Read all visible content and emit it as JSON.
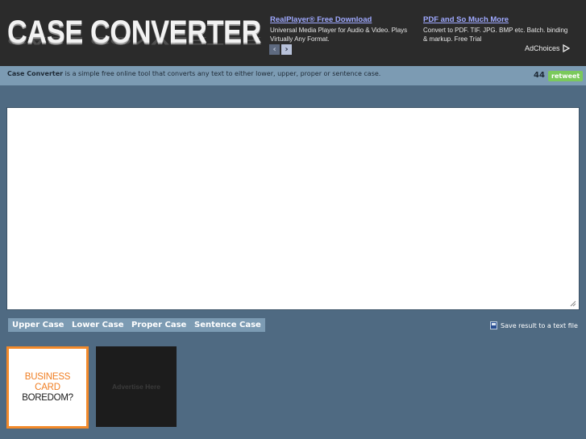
{
  "header": {
    "logo": "CASE CONVERTER",
    "ads": [
      {
        "title": "RealPlayer® Free Download",
        "text": "Universal Media Player for Audio & Video. Plays Virtually Any Format."
      },
      {
        "title": "PDF and So Much More",
        "text": "Convert to PDF. TIF. JPG. BMP etc. Batch. binding & markup. Free Trial"
      }
    ],
    "adchoices": "AdChoices"
  },
  "infobar": {
    "name": "Case Converter",
    "description": " is a simple free online tool that converts any text to either lower, upper, proper or sentence case.",
    "count": "44",
    "retweet": "retweet"
  },
  "editor": {
    "value": ""
  },
  "buttons": {
    "upper": "Upper Case",
    "lower": "Lower Case",
    "proper": "Proper Case",
    "sentence": "Sentence Case"
  },
  "save": {
    "label": "Save result to a text file"
  },
  "banners": {
    "left": {
      "line1": "BUSINESS",
      "line2": "CARD",
      "line3": "BOREDOM?"
    },
    "right": {
      "label": "Advertise Here"
    }
  },
  "colors": {
    "background": "#4f6a82",
    "header": "#2b2b2b",
    "accent": "#7c9bb3",
    "retweet": "#7bc95b",
    "banner_border": "#f38a2b"
  }
}
